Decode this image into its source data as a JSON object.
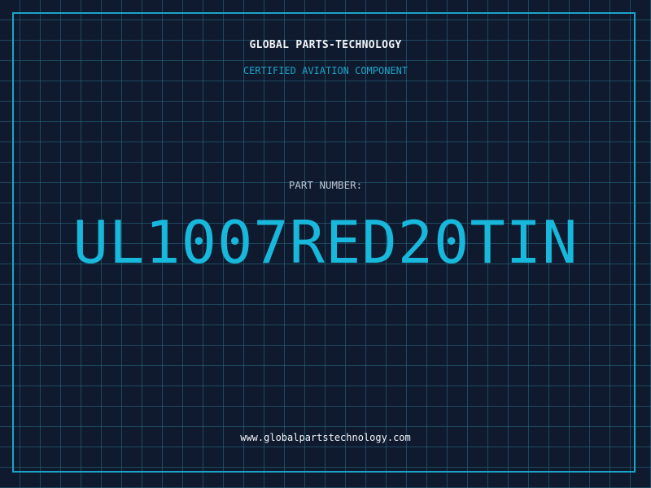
{
  "header": {
    "brand": "GLOBAL PARTS-TECHNOLOGY",
    "subtitle": "CERTIFIED AVIATION COMPONENT"
  },
  "part": {
    "label": "PART NUMBER:",
    "number": "UL1007RED20TIN"
  },
  "footer": {
    "website": "www.globalpartstechnology.com"
  },
  "colors": {
    "background": "#101a2e",
    "accent": "#18b7dc",
    "grid": "#286e87"
  }
}
